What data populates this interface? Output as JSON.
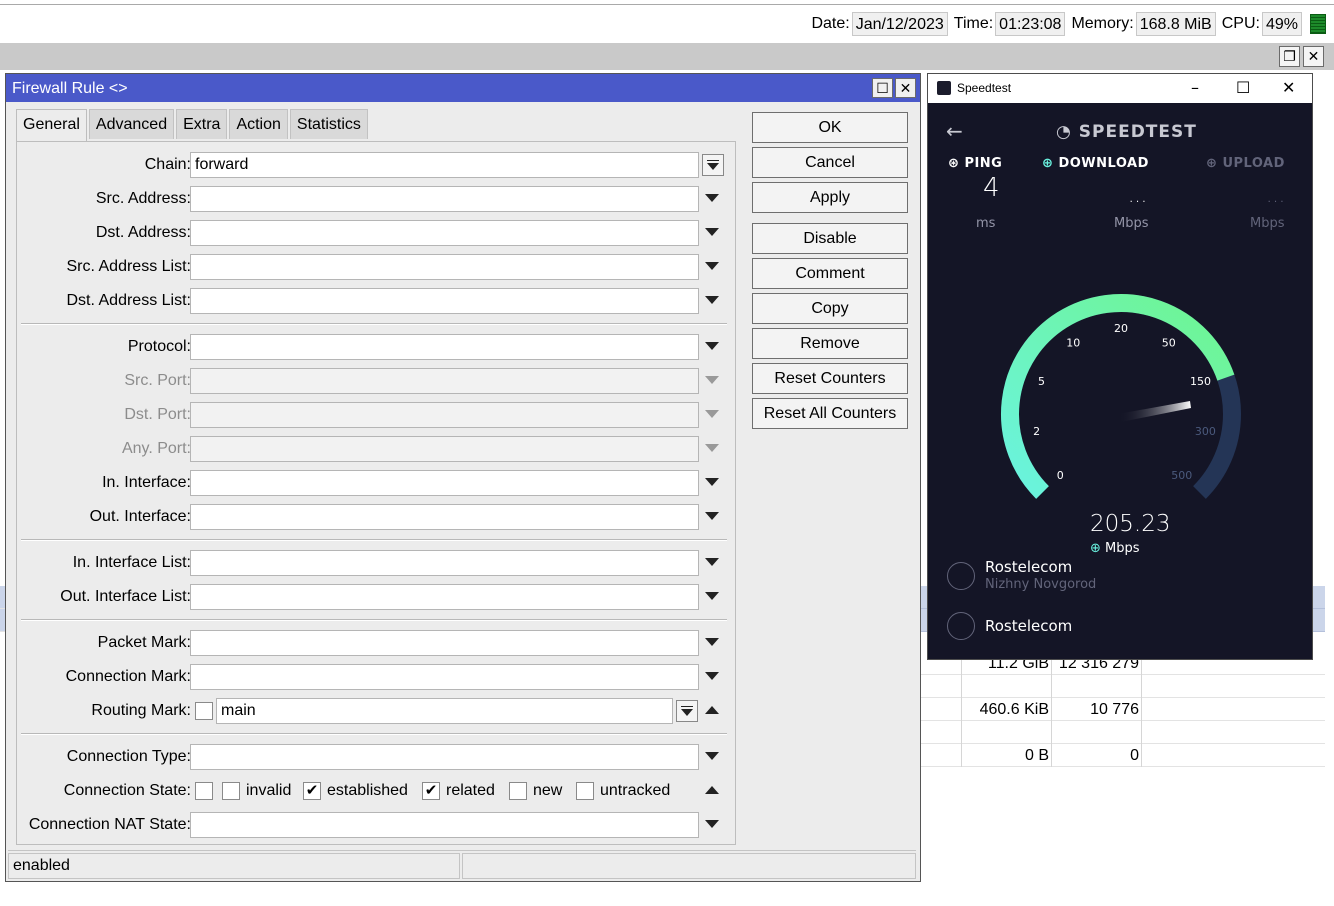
{
  "system_bar": {
    "date_label": "Date:",
    "date": "Jan/12/2023",
    "time_label": "Time:",
    "time": "01:23:08",
    "memory_label": "Memory:",
    "memory": "168.8 MiB",
    "cpu_label": "CPU:",
    "cpu": "49%"
  },
  "bg_table": {
    "rows": [
      {
        "bytes": "11.2 GiB",
        "packets": "12 316 279"
      },
      {
        "bytes": "460.6 KiB",
        "packets": "10 776"
      },
      {
        "bytes": "0 B",
        "packets": "0"
      }
    ]
  },
  "dialog": {
    "title": "Firewall Rule <>",
    "tabs": [
      "General",
      "Advanced",
      "Extra",
      "Action",
      "Statistics"
    ],
    "active_tab": "General",
    "fields": {
      "chain": {
        "label": "Chain:",
        "value": "forward"
      },
      "src_address": {
        "label": "Src. Address:"
      },
      "dst_address": {
        "label": "Dst. Address:"
      },
      "src_address_list": {
        "label": "Src. Address List:"
      },
      "dst_address_list": {
        "label": "Dst. Address List:"
      },
      "protocol": {
        "label": "Protocol:"
      },
      "src_port": {
        "label": "Src. Port:"
      },
      "dst_port": {
        "label": "Dst. Port:"
      },
      "any_port": {
        "label": "Any. Port:"
      },
      "in_interface": {
        "label": "In. Interface:"
      },
      "out_interface": {
        "label": "Out. Interface:"
      },
      "in_interface_list": {
        "label": "In. Interface List:"
      },
      "out_interface_list": {
        "label": "Out. Interface List:"
      },
      "packet_mark": {
        "label": "Packet Mark:"
      },
      "connection_mark": {
        "label": "Connection Mark:"
      },
      "routing_mark": {
        "label": "Routing Mark:",
        "value": "main"
      },
      "connection_type": {
        "label": "Connection Type:"
      },
      "connection_state": {
        "label": "Connection State:",
        "options": [
          {
            "label": "invalid",
            "checked": false
          },
          {
            "label": "established",
            "checked": true
          },
          {
            "label": "related",
            "checked": true
          },
          {
            "label": "new",
            "checked": false
          },
          {
            "label": "untracked",
            "checked": false
          }
        ]
      },
      "connection_nat_state": {
        "label": "Connection NAT State:"
      }
    },
    "buttons": {
      "ok": "OK",
      "cancel": "Cancel",
      "apply": "Apply",
      "disable": "Disable",
      "comment": "Comment",
      "copy": "Copy",
      "remove": "Remove",
      "reset_counters": "Reset Counters",
      "reset_all_counters": "Reset All Counters"
    },
    "status": "enabled"
  },
  "speedtest": {
    "window_title": "Speedtest",
    "brand": "SPEEDTEST",
    "ping": {
      "label": "PING",
      "value": "4",
      "unit": "ms"
    },
    "download": {
      "label": "DOWNLOAD",
      "value": "...",
      "unit": "Mbps"
    },
    "upload": {
      "label": "UPLOAD",
      "value": "...",
      "unit": "Mbps"
    },
    "gauge": {
      "ticks": [
        "0",
        "2",
        "5",
        "10",
        "20",
        "50",
        "150",
        "300",
        "500"
      ],
      "reading": "205.23",
      "unit": "Mbps",
      "colors": {
        "start": "#6af3e0",
        "end": "#6ff58f",
        "track": "#243556"
      }
    },
    "isp": {
      "name": "Rostelecom",
      "location": "Nizhny Novgorod"
    },
    "server": {
      "name": "Rostelecom"
    }
  },
  "colors": {
    "dialog_title": "#4a59c9",
    "selected_row": "#cbd5ea",
    "cpu_meter": "#1d8a2a"
  }
}
